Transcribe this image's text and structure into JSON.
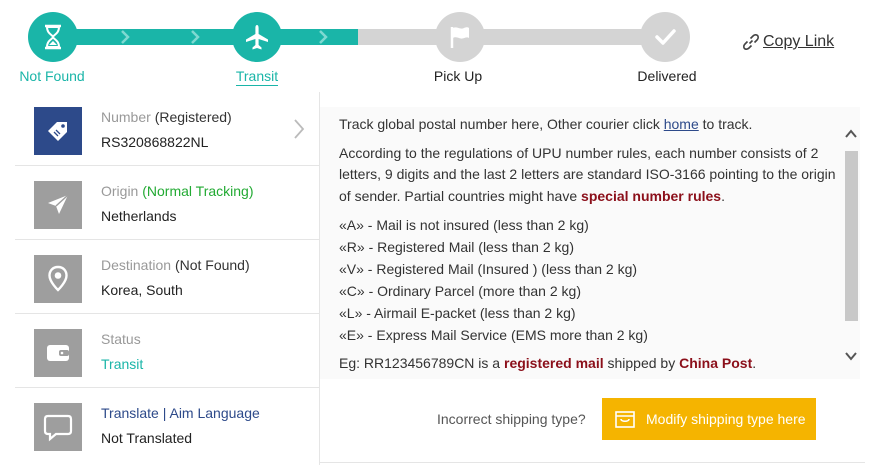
{
  "steps": [
    {
      "label": "Not Found",
      "icon": "hourglass-icon",
      "state": "done"
    },
    {
      "label": "Transit",
      "icon": "airplane-icon",
      "state": "current"
    },
    {
      "label": "Pick Up",
      "icon": "flag-icon",
      "state": "pending"
    },
    {
      "label": "Delivered",
      "icon": "checkmark-icon",
      "state": "pending"
    }
  ],
  "copy_link": {
    "label": "Copy Link",
    "icon": "link-icon"
  },
  "info": {
    "number": {
      "key": "Number",
      "tag": "(Registered)",
      "value": "RS320868822NL",
      "icon": "tag-icon"
    },
    "origin": {
      "key": "Origin",
      "tag": "(Normal Tracking)",
      "value": "Netherlands",
      "icon": "send-icon"
    },
    "destination": {
      "key": "Destination",
      "tag": "(Not Found)",
      "value": "Korea, South",
      "icon": "location-pin-icon"
    },
    "status": {
      "key": "Status",
      "value": "Transit",
      "icon": "wallet-icon"
    },
    "translate": {
      "key": "Translate | Aim Language",
      "value": "Not Translated",
      "icon": "speech-bubble-icon"
    }
  },
  "rules": {
    "intro_before": "Track global postal number here, Other courier click ",
    "intro_link": "home",
    "intro_after": " to track.",
    "para_before": "According to the regulations of UPU number rules, each number consists of 2 letters, 9 digits and the last 2 letters are standard ISO-3166 pointing to the origin of sender. Partial countries might have ",
    "para_bold": "special number rules",
    "para_after": ".",
    "lines": [
      "«A» - Mail is not insured (less than 2 kg)",
      "«R» - Registered Mail (less than 2 kg)",
      "«V» - Registered Mail (Insured ) (less than 2 kg)",
      "«C» - Ordinary Parcel (more than 2 kg)",
      "«L» - Airmail E-packet (less than 2 kg)",
      "«E» - Express Mail Service (EMS more than 2 kg)"
    ],
    "eg_before": "Eg: RR123456789CN is a ",
    "eg_bold1": "registered mail",
    "eg_mid": " shipped by ",
    "eg_bold2": "China Post",
    "eg_after": "."
  },
  "bottom": {
    "incorrect_label": "Incorrect shipping type?",
    "modify_button": "Modify shipping type here",
    "modify_icon": "box-icon"
  },
  "colors": {
    "teal": "#1ab5a8",
    "navy": "#2d4a8a",
    "amber": "#f5b400",
    "dark_red": "#8b0f1a",
    "green": "#22aa33"
  }
}
